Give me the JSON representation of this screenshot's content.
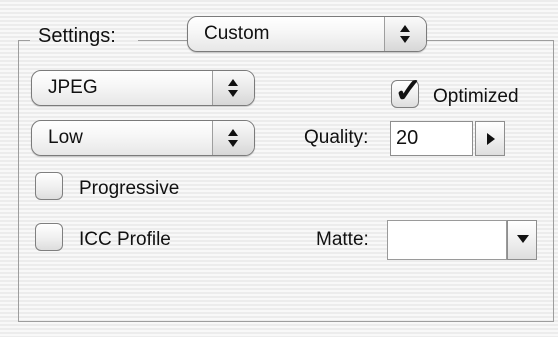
{
  "panel": {
    "settings_label": "Settings:",
    "settings_value": "Custom",
    "format_value": "JPEG",
    "quality_preset_value": "Low",
    "optimized": {
      "label": "Optimized",
      "checked": true
    },
    "quality": {
      "label": "Quality:",
      "value": "20"
    },
    "progressive": {
      "label": "Progressive",
      "checked": false
    },
    "icc_profile": {
      "label": "ICC Profile",
      "checked": false
    },
    "matte": {
      "label": "Matte:",
      "value": ""
    }
  },
  "icons": {
    "popup": "updown-icon",
    "quality_arrow": "right-arrow-icon",
    "matte_arrow": "down-arrow-icon",
    "checkmark": "checkmark-icon"
  }
}
